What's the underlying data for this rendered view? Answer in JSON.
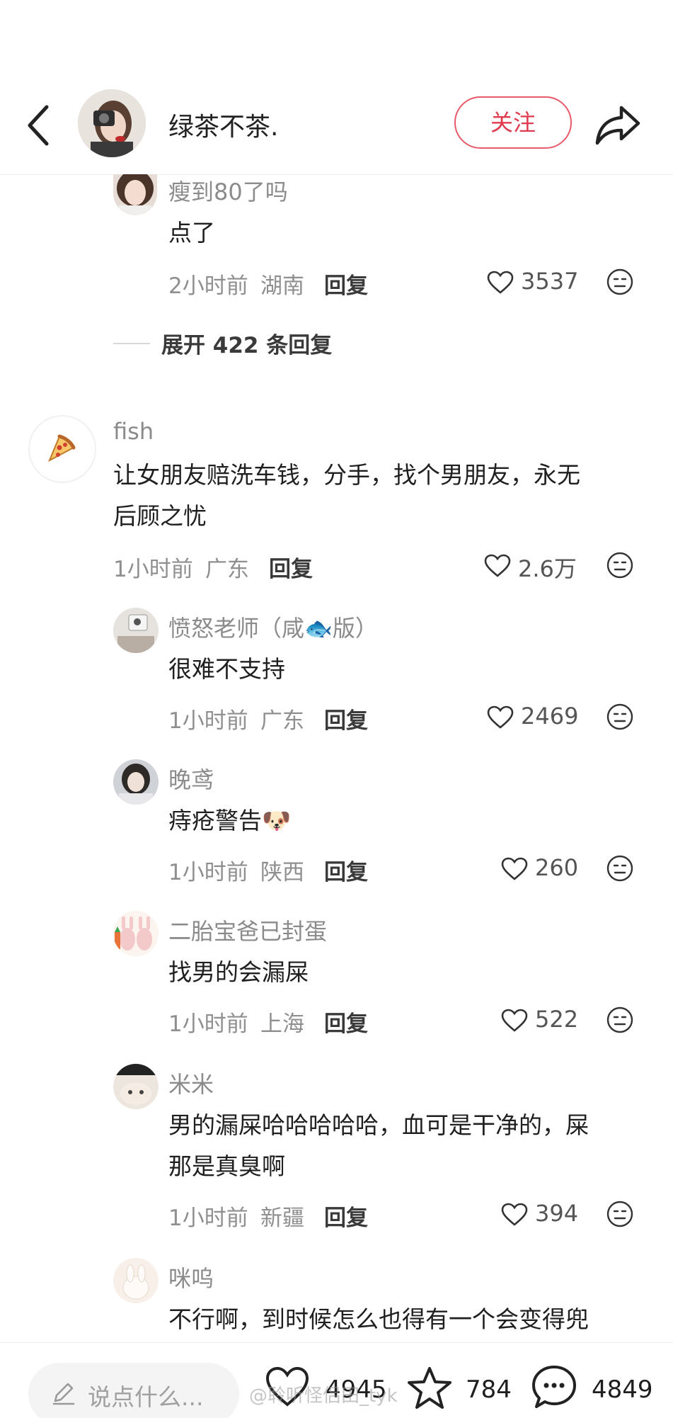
{
  "header": {
    "author_name": "绿茶不茶.",
    "follow_label": "关注"
  },
  "comments": [
    {
      "name": "瘦到80了吗",
      "text_lines": [
        "点了"
      ],
      "time": "2小时前",
      "location": "湖南",
      "reply_label": "回复",
      "likes": "3537"
    },
    {
      "name": "fish",
      "text_lines": [
        "让女朋友赔洗车钱，分手，找个男朋友，永无",
        "后顾之忧"
      ],
      "time": "1小时前",
      "location": "广东",
      "reply_label": "回复",
      "likes": "2.6万"
    },
    {
      "name": "愤怒老师（咸🐟版）",
      "text_lines": [
        "很难不支持"
      ],
      "time": "1小时前",
      "location": "广东",
      "reply_label": "回复",
      "likes": "2469"
    },
    {
      "name": "晚鸢",
      "text_lines": [
        "痔疮警告🐶"
      ],
      "time": "1小时前",
      "location": "陕西",
      "reply_label": "回复",
      "likes": "260"
    },
    {
      "name": "二胎宝爸已封蛋",
      "text_lines": [
        "找男的会漏屎"
      ],
      "time": "1小时前",
      "location": "上海",
      "reply_label": "回复",
      "likes": "522"
    },
    {
      "name": "米米",
      "text_lines": [
        "男的漏屎哈哈哈哈哈，血可是干净的，屎",
        "那是真臭啊"
      ],
      "time": "1小时前",
      "location": "新疆",
      "reply_label": "回复",
      "likes": "394"
    },
    {
      "name": "咪呜",
      "text_lines": [
        "不行啊，到时候怎么也得有一个会变得兜"
      ]
    }
  ],
  "expand_replies": "展开 422 条回复",
  "bottom": {
    "input_placeholder": "说点什么...",
    "likes": "4945",
    "favorites": "784",
    "comments": "4849"
  },
  "watermark": "@聆听怪侣田_tyk",
  "colors": {
    "accent": "#e03a4e",
    "meta_gray": "#8f8f8f"
  }
}
